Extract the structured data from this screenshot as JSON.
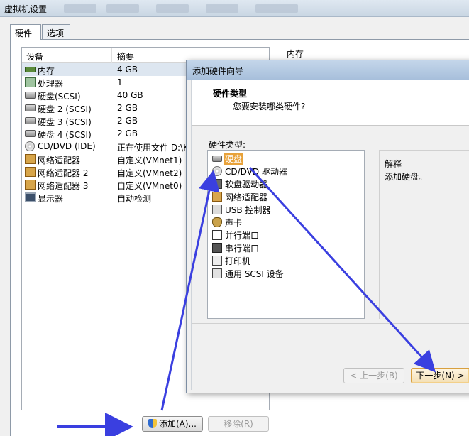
{
  "window": {
    "title": "虚拟机设置"
  },
  "tabs": [
    {
      "label": "硬件"
    },
    {
      "label": "选项"
    }
  ],
  "device_list": {
    "headers": {
      "device": "设备",
      "summary": "摘要"
    },
    "rows": [
      {
        "name": "内存",
        "summary": "4 GB",
        "icon": "memory-icon"
      },
      {
        "name": "处理器",
        "summary": "1",
        "icon": "processor-icon"
      },
      {
        "name": "硬盘(SCSI)",
        "summary": "40 GB",
        "icon": "hard-disk-icon"
      },
      {
        "name": "硬盘 2 (SCSI)",
        "summary": "2 GB",
        "icon": "hard-disk-icon"
      },
      {
        "name": "硬盘 3 (SCSI)",
        "summary": "2 GB",
        "icon": "hard-disk-icon"
      },
      {
        "name": "硬盘 4 (SCSI)",
        "summary": "2 GB",
        "icon": "hard-disk-icon"
      },
      {
        "name": "CD/DVD (IDE)",
        "summary": "正在使用文件 D:\\K",
        "icon": "cd-dvd-icon"
      },
      {
        "name": "网络适配器",
        "summary": "自定义(VMnet1)",
        "icon": "network-adapter-icon"
      },
      {
        "name": "网络适配器 2",
        "summary": "自定义(VMnet2)",
        "icon": "network-adapter-icon"
      },
      {
        "name": "网络适配器 3",
        "summary": "自定义(VMnet0)",
        "icon": "network-adapter-icon"
      },
      {
        "name": "显示器",
        "summary": "自动检测",
        "icon": "display-icon"
      }
    ]
  },
  "memory_panel": {
    "label": "内存"
  },
  "buttons": {
    "add": "添加(A)...",
    "remove": "移除(R)"
  },
  "wizard": {
    "title": "添加硬件向导",
    "header_title": "硬件类型",
    "header_subtitle": "您要安装哪类硬件?",
    "list_label": "硬件类型:",
    "items": [
      {
        "label": "硬盘",
        "icon": "hard-disk-icon"
      },
      {
        "label": "CD/DVD 驱动器",
        "icon": "cd-dvd-icon"
      },
      {
        "label": "软盘驱动器",
        "icon": "floppy-icon"
      },
      {
        "label": "网络适配器",
        "icon": "network-adapter-icon"
      },
      {
        "label": "USB 控制器",
        "icon": "usb-icon"
      },
      {
        "label": "声卡",
        "icon": "sound-card-icon"
      },
      {
        "label": "并行端口",
        "icon": "parallel-port-icon"
      },
      {
        "label": "串行端口",
        "icon": "serial-port-icon"
      },
      {
        "label": "打印机",
        "icon": "printer-icon"
      },
      {
        "label": "通用 SCSI 设备",
        "icon": "scsi-icon"
      }
    ],
    "description_title": "解释",
    "description_text": "添加硬盘。",
    "back_button": "< 上一步(B)",
    "next_button": "下一步(N) >"
  },
  "colors": {
    "selection": "#e8a23a",
    "arrow": "#3a3fe0"
  }
}
